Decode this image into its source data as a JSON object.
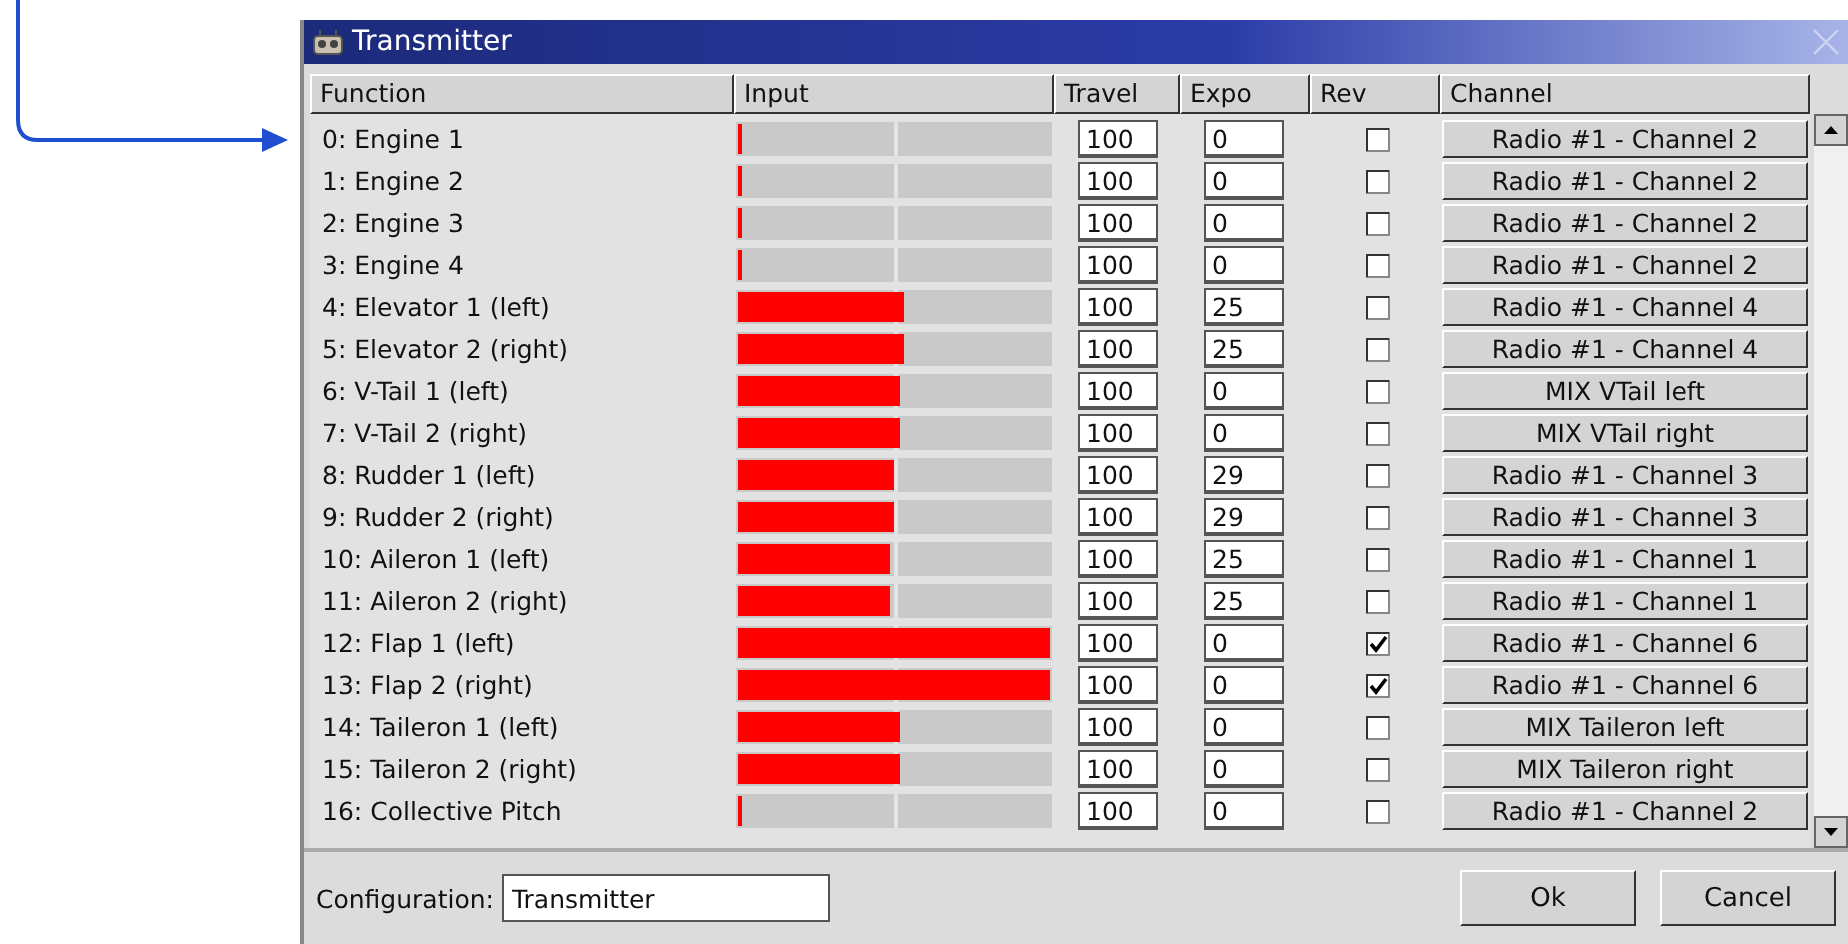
{
  "window": {
    "title": "Transmitter"
  },
  "table": {
    "columns": [
      "Function",
      "Input",
      "Travel",
      "Expo",
      "Rev",
      "Channel"
    ],
    "rows": [
      {
        "function": "0: Engine 1",
        "level": 0.01,
        "travel": "100",
        "expo": "0",
        "rev": false,
        "channel": "Radio #1 - Channel 2"
      },
      {
        "function": "1: Engine 2",
        "level": 0.01,
        "travel": "100",
        "expo": "0",
        "rev": false,
        "channel": "Radio #1 - Channel 2"
      },
      {
        "function": "2: Engine 3",
        "level": 0.01,
        "travel": "100",
        "expo": "0",
        "rev": false,
        "channel": "Radio #1 - Channel 2"
      },
      {
        "function": "3: Engine 4",
        "level": 0.01,
        "travel": "100",
        "expo": "0",
        "rev": false,
        "channel": "Radio #1 - Channel 2"
      },
      {
        "function": "4: Elevator 1 (left)",
        "level": 0.53,
        "travel": "100",
        "expo": "25",
        "rev": false,
        "channel": "Radio #1 - Channel 4"
      },
      {
        "function": "5: Elevator 2 (right)",
        "level": 0.53,
        "travel": "100",
        "expo": "25",
        "rev": false,
        "channel": "Radio #1 - Channel 4"
      },
      {
        "function": "6: V-Tail 1 (left)",
        "level": 0.52,
        "travel": "100",
        "expo": "0",
        "rev": false,
        "channel": "MIX VTail left"
      },
      {
        "function": "7: V-Tail 2 (right)",
        "level": 0.52,
        "travel": "100",
        "expo": "0",
        "rev": false,
        "channel": "MIX VTail right"
      },
      {
        "function": "8: Rudder 1 (left)",
        "level": 0.5,
        "travel": "100",
        "expo": "29",
        "rev": false,
        "channel": "Radio #1 - Channel 3"
      },
      {
        "function": "9: Rudder 2 (right)",
        "level": 0.5,
        "travel": "100",
        "expo": "29",
        "rev": false,
        "channel": "Radio #1 - Channel 3"
      },
      {
        "function": "10: Aileron 1 (left)",
        "level": 0.49,
        "travel": "100",
        "expo": "25",
        "rev": false,
        "channel": "Radio #1 - Channel 1"
      },
      {
        "function": "11: Aileron 2 (right)",
        "level": 0.49,
        "travel": "100",
        "expo": "25",
        "rev": false,
        "channel": "Radio #1 - Channel 1"
      },
      {
        "function": "12: Flap 1 (left)",
        "level": 1,
        "travel": "100",
        "expo": "0",
        "rev": true,
        "channel": "Radio #1 - Channel 6"
      },
      {
        "function": "13: Flap 2 (right)",
        "level": 1,
        "travel": "100",
        "expo": "0",
        "rev": true,
        "channel": "Radio #1 - Channel 6"
      },
      {
        "function": "14: Taileron 1 (left)",
        "level": 0.52,
        "travel": "100",
        "expo": "0",
        "rev": false,
        "channel": "MIX Taileron left"
      },
      {
        "function": "15: Taileron 2 (right)",
        "level": 0.52,
        "travel": "100",
        "expo": "0",
        "rev": false,
        "channel": "MIX Taileron right"
      },
      {
        "function": "16: Collective Pitch",
        "level": 0.01,
        "travel": "100",
        "expo": "0",
        "rev": false,
        "channel": "Radio #1 - Channel 2"
      }
    ]
  },
  "footer": {
    "configuration_label": "Configuration:",
    "configuration_value": "Transmitter",
    "buttons": [
      "Ok",
      "Cancel"
    ]
  }
}
